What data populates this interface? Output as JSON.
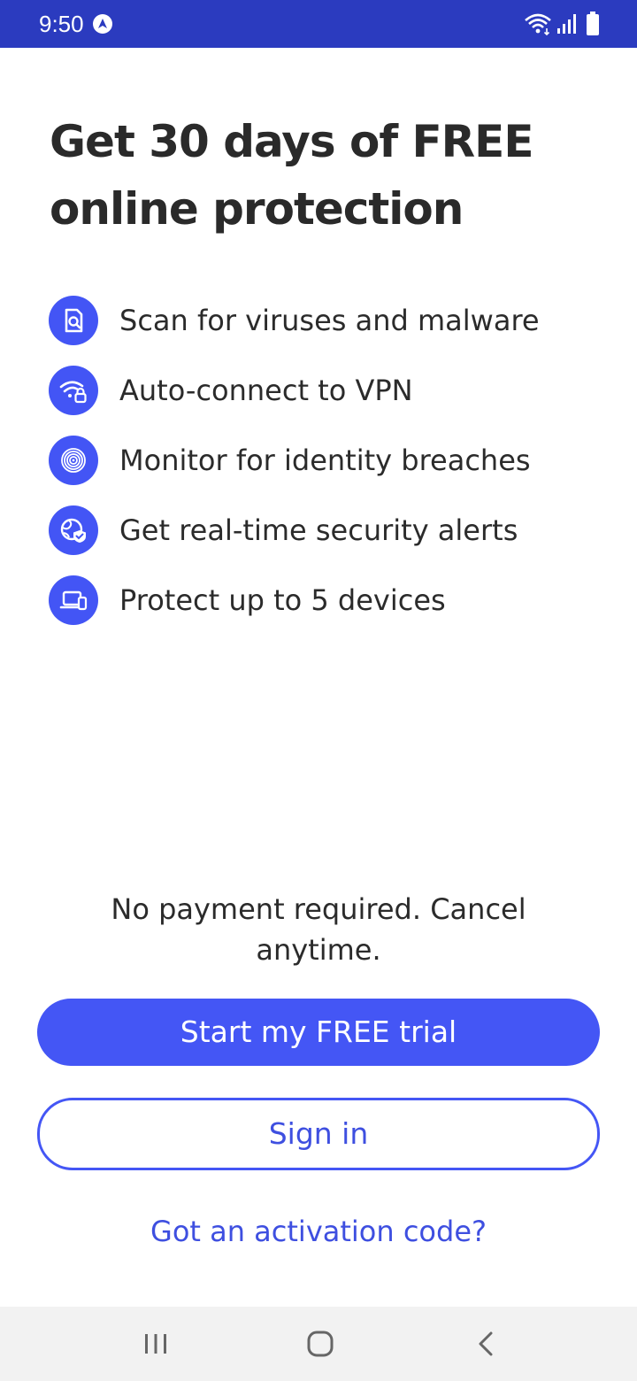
{
  "status_bar": {
    "time": "9:50",
    "app_icon": "navigation-arrow-icon",
    "icons": [
      "wifi-icon",
      "signal-icon",
      "battery-icon"
    ]
  },
  "onboarding": {
    "title": "Get 30 days of FREE online protection",
    "features": [
      {
        "icon": "file-scan-icon",
        "label": "Scan for viruses and malware"
      },
      {
        "icon": "wifi-lock-icon",
        "label": "Auto-connect to VPN"
      },
      {
        "icon": "fingerprint-icon",
        "label": "Monitor for identity breaches"
      },
      {
        "icon": "globe-shield-icon",
        "label": "Get real-time security alerts"
      },
      {
        "icon": "devices-icon",
        "label": "Protect up to 5 devices"
      }
    ],
    "disclaimer": "No payment required. Cancel anytime.",
    "primary_button": "Start my FREE trial",
    "secondary_button": "Sign in",
    "activation_link": "Got an activation code?"
  },
  "navigation_bar": {
    "buttons": [
      "recents-icon",
      "home-icon",
      "back-icon"
    ]
  },
  "colors": {
    "status_bar": "#2b3bbf",
    "accent": "#4456f5",
    "text": "#2b2b2b",
    "nav_bar": "#f2f2f2"
  }
}
